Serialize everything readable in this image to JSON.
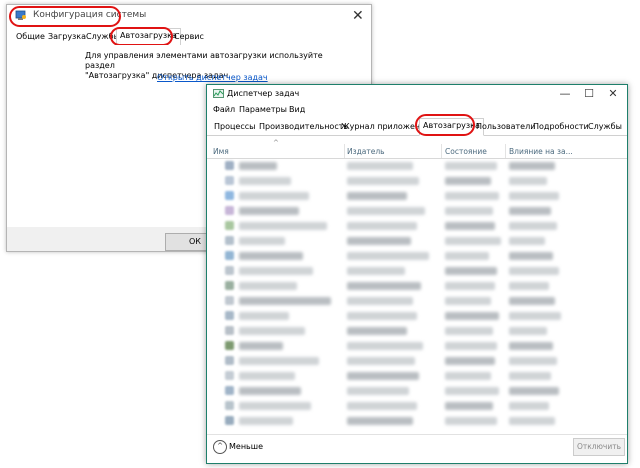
{
  "msconfig": {
    "title": "Конфигурация системы",
    "close_glyph": "✕",
    "tabs": [
      "Общие",
      "Загрузка",
      "Службы",
      "Автозагрузка",
      "Сервис"
    ],
    "active_tab": "Автозагрузка",
    "message_line1": "Для управления элементами автозагрузки используйте раздел",
    "message_line2": "\"Автозагрузка\" диспетчера задач.",
    "link": "Открыть диспетчер задач",
    "ok_label": "ОК"
  },
  "taskmgr": {
    "title": "Диспетчер задач",
    "window_buttons": {
      "minimize": "—",
      "maximize": "☐",
      "close": "✕"
    },
    "menu": [
      "Файл",
      "Параметры",
      "Вид"
    ],
    "tabs": [
      "Процессы",
      "Производительность",
      "Журнал приложений",
      "Автозагрузка",
      "Пользователи",
      "Подробности",
      "Службы"
    ],
    "active_tab": "Автозагрузка",
    "sort_caret": "^",
    "columns": [
      "Имя",
      "Издатель",
      "Состояние",
      "Влияние на за..."
    ],
    "less_label": "Меньше",
    "less_glyph": "^",
    "disable_label": "Отключить"
  },
  "colors": {
    "highlight": "#e01313",
    "taskmgr_border": "#1e7f6b",
    "link": "#0a58ca"
  }
}
